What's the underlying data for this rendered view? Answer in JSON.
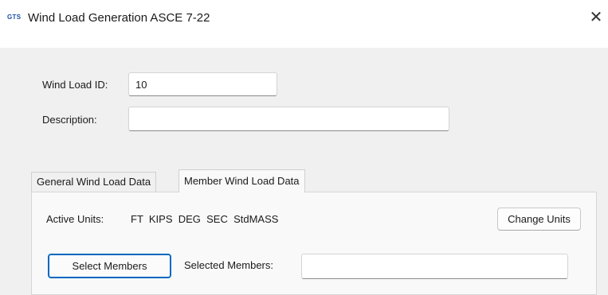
{
  "window": {
    "app_icon_text": "GTS",
    "title": "Wind Load Generation ASCE 7-22",
    "close_symbol": "✕"
  },
  "form": {
    "wind_load_id_label": "Wind Load ID:",
    "wind_load_id_value": "10",
    "description_label": "Description:",
    "description_value": ""
  },
  "tabs": [
    {
      "label": "General Wind Load Data",
      "active": false
    },
    {
      "label": "Member Wind Load Data",
      "active": true
    }
  ],
  "member_tab": {
    "active_units_label": "Active Units:",
    "active_units_value": "FT  KIPS  DEG  SEC  StdMASS",
    "change_units_button": "Change Units",
    "select_members_button": "Select Members",
    "selected_members_label": "Selected Members:",
    "selected_members_value": ""
  },
  "colors": {
    "accent": "#0067c0",
    "icon_blue": "#1f4fa8"
  }
}
